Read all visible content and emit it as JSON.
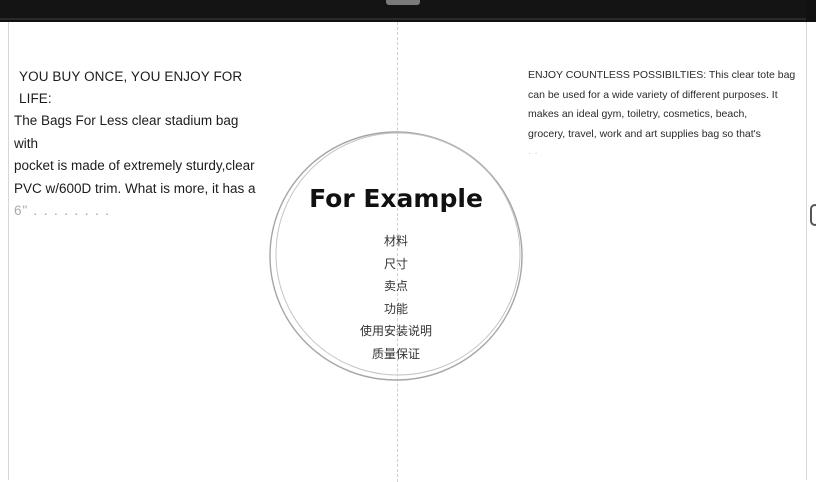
{
  "left_panel": {
    "heading": "YOU BUY ONCE, YOU ENJOY FOR LIFE:",
    "lines": [
      "The  Bags For Less clear stadium bag with",
      "pocket is made of extremely sturdy,clear",
      "PVC w/600D trim. What is more, it has a"
    ],
    "faded_line": "6\" ․ ․ ․ ․ ․ ․ ․ ․"
  },
  "right_panel": {
    "lines": [
      "ENJOY COUNTLESS POSSIBILTIES: This clear tote bag",
      "can be used  for a wide variety of different purposes. It",
      "makes  an ideal gym,  toiletry,  cosmetics,  beach,",
      "grocery,  travel,  work and art supplies bag so that's"
    ],
    "ghost_line": "· ·"
  },
  "center": {
    "title": "For Example",
    "menu_items": [
      "材料",
      "尺寸",
      "卖点",
      "功能",
      "使用安装说明",
      "质量保证"
    ]
  },
  "colors": {
    "top_bar": "#111111",
    "circle_stroke": "#9a9a9a",
    "text": "#1c1c1c"
  }
}
